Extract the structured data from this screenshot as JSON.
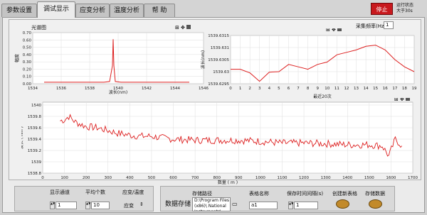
{
  "tabs": [
    {
      "label": "参数设置"
    },
    {
      "label": "调试显示"
    },
    {
      "label": "应变分析"
    },
    {
      "label": "温度分析"
    },
    {
      "label": "帮 助"
    }
  ],
  "stop_button": {
    "label": "停止"
  },
  "status_text": "运行状态\n大于30s",
  "sample_rate": {
    "label": "采集频率(Hz)",
    "value": "1"
  },
  "spectrum_chart": {
    "title": "光谱图",
    "xlabel": "波长(nm)",
    "ylabel": "幅度",
    "xticks": [
      "1534",
      "1536",
      "1538",
      "1540",
      "1542",
      "1544",
      "1546"
    ],
    "yticks": [
      "0.70",
      "0.60",
      "0.50",
      "0.40",
      "0.30",
      "0.20",
      "0.10",
      "0.00"
    ]
  },
  "recent_chart": {
    "xlabel": "最近20次",
    "ylabel": "波长(nm)",
    "xticks": [
      "0",
      "1",
      "2",
      "3",
      "4",
      "5",
      "6",
      "7",
      "8",
      "9",
      "10",
      "11",
      "12",
      "13",
      "14",
      "15",
      "16",
      "17",
      "18",
      "19"
    ],
    "yticks": [
      "1539.6315",
      "1539.631",
      "1539.6305",
      "1539.63",
      "1539.6295"
    ]
  },
  "long_chart": {
    "xlabel": "数量 ( m )",
    "ylabel": "波长 ( nm )",
    "xticks": [
      "0",
      "100",
      "200",
      "300",
      "400",
      "500",
      "600",
      "700",
      "800",
      "900",
      "1000",
      "1100",
      "1200",
      "1300",
      "1400",
      "1500",
      "1600",
      "1700"
    ],
    "yticks": [
      "1540",
      "1539.8",
      "1539.6",
      "1539.4",
      "1539.2",
      "1539",
      "1538.8"
    ]
  },
  "controls": {
    "channel": {
      "label": "显示通道",
      "value": "1"
    },
    "avg": {
      "label": "平均个数",
      "value": "10"
    },
    "mode": {
      "label": "应变/温度",
      "value": "应变"
    },
    "storage_title": "数据存储",
    "path": {
      "label": "存储路径",
      "value": "D:\\Program Files (x86)\\ National Instruments\\"
    },
    "table": {
      "label": "表格名称",
      "value": "a1"
    },
    "interval": {
      "label": "保存时间间隔(s)",
      "value": "1"
    },
    "create_btn": "创建新表格",
    "save_btn": "存储数据"
  },
  "chart_data": [
    {
      "type": "line",
      "title": "光谱图",
      "xlabel": "波长(nm)",
      "ylabel": "幅度",
      "xlim": [
        1534,
        1546
      ],
      "ylim": [
        0,
        0.7
      ],
      "x": [
        1534.8,
        1536,
        1537,
        1538,
        1539,
        1539.4,
        1539.6,
        1539.65,
        1539.7,
        1539.8,
        1540.2,
        1541,
        1542,
        1543,
        1544,
        1545
      ],
      "y": [
        0.02,
        0.02,
        0.02,
        0.02,
        0.02,
        0.03,
        0.25,
        0.61,
        0.25,
        0.03,
        0.02,
        0.02,
        0.02,
        0.02,
        0.02,
        0.02
      ]
    },
    {
      "type": "line",
      "xlabel": "最近20次",
      "ylabel": "波长(nm)",
      "xlim": [
        0,
        19
      ],
      "ylim": [
        1539.6295,
        1539.6315
      ],
      "x": [
        0,
        1,
        2,
        3,
        4,
        5,
        6,
        7,
        8,
        9,
        10,
        11,
        12,
        13,
        14,
        15,
        16,
        17,
        18,
        19
      ],
      "y": [
        1539.6301,
        1539.6301,
        1539.62995,
        1539.6296,
        1539.62998,
        1539.63,
        1539.6303,
        1539.6302,
        1539.6301,
        1539.6303,
        1539.6304,
        1539.6307,
        1539.6308,
        1539.6309,
        1539.63105,
        1539.6311,
        1539.6309,
        1539.6305,
        1539.6302,
        1539.63
      ]
    },
    {
      "type": "line",
      "xlabel": "数量 ( m )",
      "ylabel": "波长 ( nm )",
      "xlim": [
        0,
        1700
      ],
      "ylim": [
        1538.8,
        1540.05
      ],
      "x": [
        80,
        100,
        120,
        150,
        200,
        250,
        300,
        350,
        400,
        450,
        500,
        550,
        600,
        700,
        800,
        900,
        1000,
        1100,
        1200,
        1300,
        1400,
        1500,
        1560,
        1590,
        1620,
        1650
      ],
      "y": [
        1539.72,
        1539.74,
        1539.8,
        1539.7,
        1539.62,
        1539.6,
        1539.55,
        1539.5,
        1539.47,
        1539.45,
        1539.45,
        1539.42,
        1539.4,
        1539.38,
        1539.38,
        1539.38,
        1539.36,
        1539.33,
        1539.33,
        1539.32,
        1539.3,
        1539.3,
        1539.28,
        1539.1,
        1539.4,
        1539.28
      ]
    }
  ]
}
